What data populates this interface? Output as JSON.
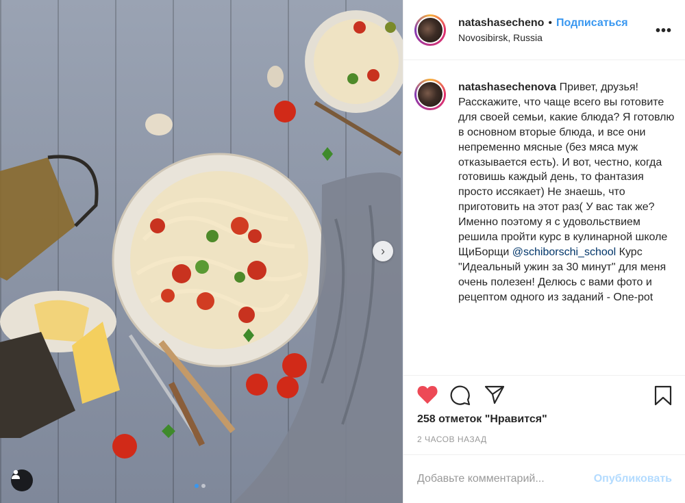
{
  "post": {
    "image_alt": "Pasta with cherry tomatoes on a wooden table"
  },
  "photo_controls": {
    "next_glyph": "›",
    "dots_count": 2,
    "active_dot": 0
  },
  "header": {
    "username": "natashasecheno",
    "separator": "•",
    "follow_label": "Подписаться",
    "location": "Novosibirsk, Russia",
    "more_label": "•••"
  },
  "caption": {
    "username": "natashasechenova",
    "text_before_mention": "Привет, друзья! Расскажите, что чаще всего вы готовите для своей семьи, какие блюда? Я готовлю в основном вторые блюда, и все они непременно мясные (без мяса муж отказывается есть). И вот, честно, когда готовишь каждый день, то фантазия просто иссякает) Не знаешь, что приготовить на этот раз( У вас так же? Именно поэтому я с удовольствием решила пройти курс в кулинарной школе ЩиБорщи ",
    "mention": "@schiborschi_school",
    "text_after_mention": " Курс \"Идеальный ужин за 30 минут\" для меня очень полезен! Делюсь с вами фото и рецептом одного из заданий - One-pot"
  },
  "actions": {
    "like_icon": "heart-icon",
    "comment_icon": "comment-icon",
    "share_icon": "share-icon",
    "save_icon": "bookmark-icon",
    "like_color": "#ed4956"
  },
  "likes_text": "258 отметок \"Нравится\"",
  "time_text": "2 ЧАСОВ НАЗАД",
  "comment": {
    "placeholder": "Добавьте комментарий...",
    "publish_label": "Опубликовать"
  }
}
